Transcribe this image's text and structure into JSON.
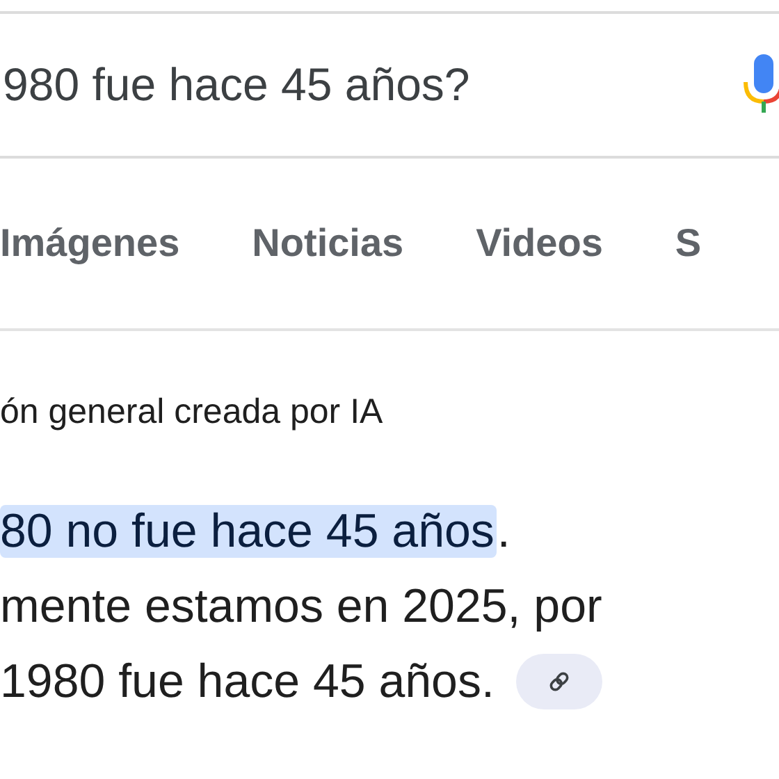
{
  "search": {
    "value": "980 fue hace 45 años?"
  },
  "tabs": [
    {
      "label": "Imágenes",
      "selected": false
    },
    {
      "label": "Noticias",
      "selected": false
    },
    {
      "label": "Videos",
      "selected": false
    },
    {
      "label": "S",
      "selected": false
    }
  ],
  "ai_overview": {
    "heading": "ón general creada por IA",
    "highlight": "80 no fue hace 45 años",
    "highlight_end": ".",
    "lines": [
      "mente estamos en 2025, por",
      "1980 fue hace 45 años."
    ]
  }
}
